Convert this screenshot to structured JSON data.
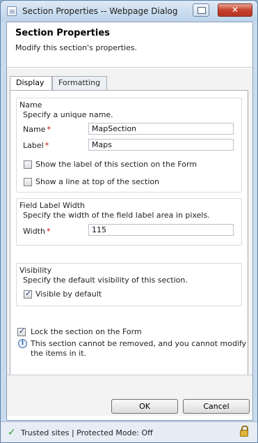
{
  "window": {
    "title": "Section Properties -- Webpage Dialog",
    "close_glyph": "✕"
  },
  "header": {
    "title": "Section Properties",
    "subtitle": "Modify this section's properties."
  },
  "tabs": [
    {
      "label": "Display",
      "active": true
    },
    {
      "label": "Formatting",
      "active": false
    }
  ],
  "name_group": {
    "title": "Name",
    "description": "Specify a unique name.",
    "name_label": "Name",
    "name_value": "MapSection",
    "label_label": "Label",
    "label_value": "Maps",
    "show_label_text": "Show the label of this section on the Form",
    "show_label_checked": false,
    "show_line_text": "Show a line at top of the section",
    "show_line_checked": false,
    "required_marker": "*"
  },
  "field_width_group": {
    "title": "Field Label Width",
    "description": "Specify the width of the field label area in pixels.",
    "width_label": "Width",
    "width_value": "115"
  },
  "visibility_group": {
    "title": "Visibility",
    "description": "Specify the default visibility of this section.",
    "visible_text": "Visible by default",
    "visible_checked": true
  },
  "lock": {
    "text": "Lock the section on the Form",
    "checked": true,
    "info_text_line1": "This section cannot be removed, and you cannot modify",
    "info_text_line2": "the items in it.",
    "info_icon_glyph": "i"
  },
  "buttons": {
    "ok": "OK",
    "cancel": "Cancel"
  },
  "status": {
    "check_glyph": "✓",
    "text": "Trusted sites | Protected Mode: Off"
  },
  "icons": {
    "app": "dialog-icon",
    "compat": "compatibility-view-icon",
    "close": "close-icon",
    "info": "info-icon",
    "trusted": "check-icon",
    "lock": "lock-icon"
  }
}
